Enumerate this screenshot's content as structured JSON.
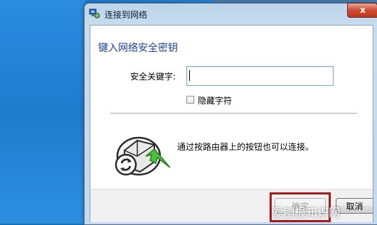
{
  "window": {
    "title": "连接到网络",
    "close_label": "x"
  },
  "dialog": {
    "heading": "键入网络安全密钥",
    "security_key_label": "安全关键字:",
    "security_key_value": "",
    "hide_characters_label": "隐藏字符",
    "hide_characters_checked": false,
    "router_hint": "通过按路由器上的按钮也可以连接。"
  },
  "buttons": {
    "ok_label": "确定",
    "cancel_label": "取消"
  },
  "overlay": {
    "watermark": "爱刨根知识网"
  },
  "colors": {
    "heading": "#1a3f9c",
    "highlight_frame": "#a91b1b",
    "close_button": "#c0361f"
  },
  "icons": {
    "title": "network-globe-icon",
    "router": "router-push-button-icon"
  }
}
